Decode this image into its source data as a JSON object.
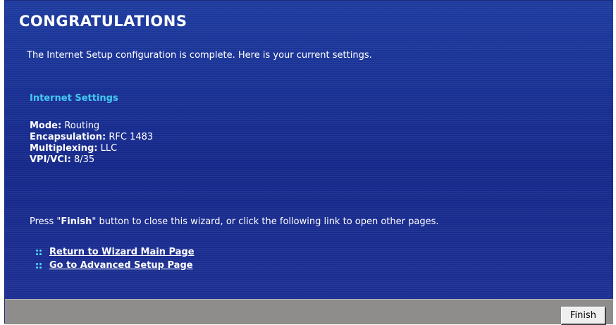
{
  "header": {
    "title": "CONGRATULATIONS"
  },
  "intro": "The Internet Setup configuration is complete. Here is your current settings.",
  "internet_settings": {
    "heading": "Internet Settings",
    "items": [
      {
        "label": "Mode:",
        "value": "Routing"
      },
      {
        "label": "Encapsulation:",
        "value": "RFC 1483"
      },
      {
        "label": "Multiplexing:",
        "value": "LLC"
      },
      {
        "label": "VPI/VCI:",
        "value": "8/35"
      }
    ]
  },
  "instructions": {
    "prefix": "Press \"",
    "bold": "Finish",
    "suffix": "\" button to close this wizard, or click the following link to open other pages."
  },
  "links": [
    {
      "label": "Return to Wizard Main Page",
      "icon": "bullet-icon"
    },
    {
      "label": "Go to Advanced Setup Page",
      "icon": "bullet-icon"
    }
  ],
  "footer": {
    "finish_label": "Finish"
  },
  "colors": {
    "panel_background": "#1c3296",
    "heading_accent": "#44c8f4",
    "footer_background": "#8e8d8b"
  }
}
